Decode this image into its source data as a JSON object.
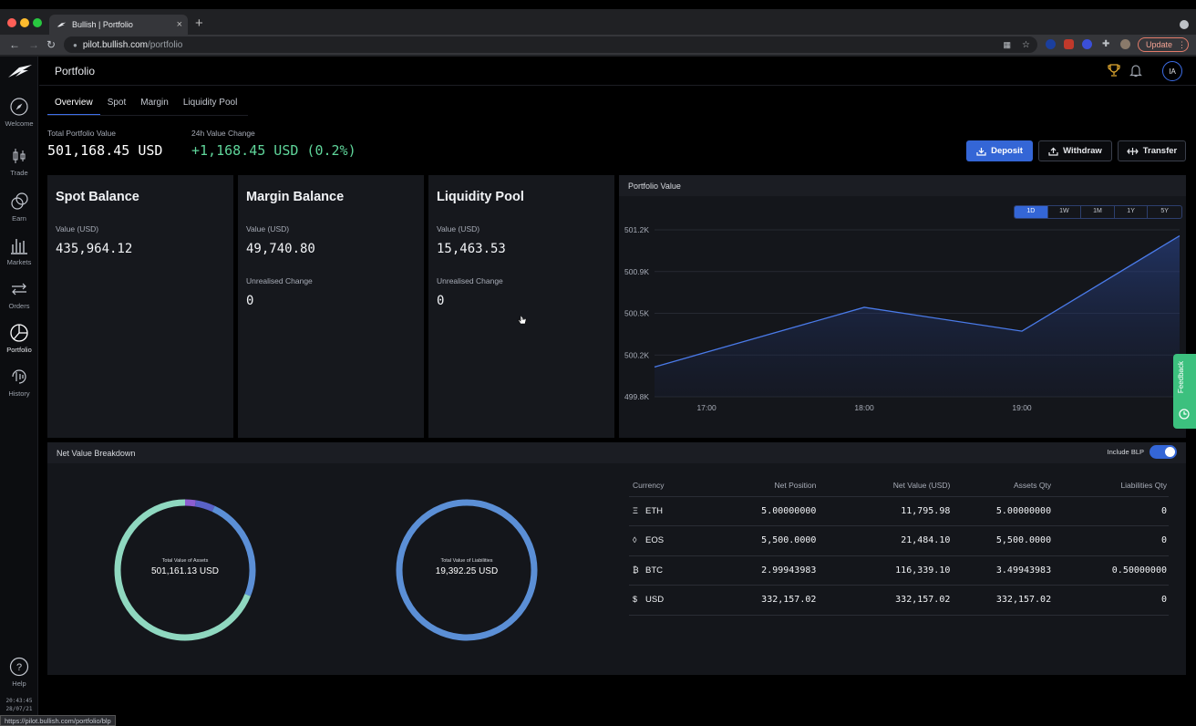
{
  "browser": {
    "tab_title": "Bullish | Portfolio",
    "tab_close": "×",
    "new_tab": "+",
    "url_host": "pilot.bullish.com",
    "url_path": "/portfolio",
    "update_label": "Update",
    "status_url": "https://pilot.bullish.com/portfolio/blp"
  },
  "sidebar": {
    "items": [
      {
        "label": "Welcome",
        "icon": "compass-icon"
      },
      {
        "label": "Trade",
        "icon": "candlestick-icon"
      },
      {
        "label": "Earn",
        "icon": "coins-icon"
      },
      {
        "label": "Markets",
        "icon": "bar-chart-icon"
      },
      {
        "label": "Orders",
        "icon": "arrows-icon"
      },
      {
        "label": "Portfolio",
        "icon": "pie-chart-icon"
      },
      {
        "label": "History",
        "icon": "history-icon"
      }
    ],
    "help_label": "Help",
    "clock_time": "20:43:45",
    "clock_date": "28/07/21"
  },
  "header": {
    "title": "Portfolio",
    "avatar_initials": "IA"
  },
  "tabs": [
    "Overview",
    "Spot",
    "Margin",
    "Liquidity Pool"
  ],
  "summary": {
    "total_label": "Total Portfolio Value",
    "total_value": "501,168.45 USD",
    "change_label": "24h Value Change",
    "change_value": "+1,168.45 USD (0.2%)"
  },
  "actions": {
    "deposit": "Deposit",
    "withdraw": "Withdraw",
    "transfer": "Transfer"
  },
  "cards": {
    "spot": {
      "title": "Spot Balance",
      "value_label": "Value (USD)",
      "value": "435,964.12"
    },
    "margin": {
      "title": "Margin Balance",
      "value_label": "Value (USD)",
      "value": "49,740.80",
      "change_label": "Unrealised Change",
      "change": "0"
    },
    "pool": {
      "title": "Liquidity Pool",
      "value_label": "Value (USD)",
      "value": "15,463.53",
      "change_label": "Unrealised Change",
      "change": "0"
    }
  },
  "portfolio_chart": {
    "title": "Portfolio Value",
    "ranges": [
      "1D",
      "1W",
      "1M",
      "1Y",
      "5Y"
    ],
    "active_range": "1D"
  },
  "chart_data": {
    "type": "area",
    "title": "Portfolio Value",
    "x": [
      "16:40",
      "18:00",
      "19:00",
      "20:00"
    ],
    "x_numeric_hours": [
      16.67,
      18.0,
      19.0,
      20.0
    ],
    "series": [
      {
        "values": [
          500.05,
          500.55,
          500.35,
          501.15
        ]
      }
    ],
    "x_ticks": [
      "17:00",
      "18:00",
      "19:00"
    ],
    "y_ticks": [
      "499.8K",
      "500.2K",
      "500.5K",
      "500.9K",
      "501.2K"
    ],
    "y_tick_values": [
      499.8,
      500.15,
      500.5,
      500.85,
      501.2
    ],
    "ylim": [
      499.8,
      501.2
    ],
    "xlim": [
      16.67,
      20.0
    ],
    "grid": true,
    "line_color": "#4a7ae8"
  },
  "breakdown": {
    "title": "Net Value Breakdown",
    "blp_label": "Include BLP",
    "assets_label": "Total Value of Assets",
    "assets_value": "501,161.13 USD",
    "liab_label": "Total Value of Liabilities",
    "liab_value": "19,392.25 USD",
    "assets_segments": [
      {
        "currency": "USD",
        "value": 332157.02,
        "color": "#8fd8c0"
      },
      {
        "currency": "BTC",
        "value": 116339.1,
        "color": "#5b8fd6"
      },
      {
        "currency": "EOS",
        "value": 21484.1,
        "color": "#5a62c8"
      },
      {
        "currency": "ETH",
        "value": 11795.98,
        "color": "#8d5ed0"
      }
    ],
    "liab_segments": [
      {
        "currency": "BTC",
        "value": 19392.25,
        "color": "#5b8fd6"
      }
    ],
    "columns": [
      "Currency",
      "Net Position",
      "Net Value (USD)",
      "Assets Qty",
      "Liabilities Qty"
    ],
    "rows": [
      {
        "icon": "Ξ",
        "currency": "ETH",
        "net_position": "5.00000000",
        "net_value": "11,795.98",
        "assets_qty": "5.00000000",
        "liab_qty": "0"
      },
      {
        "icon": "◊",
        "currency": "EOS",
        "net_position": "5,500.0000",
        "net_value": "21,484.10",
        "assets_qty": "5,500.0000",
        "liab_qty": "0"
      },
      {
        "icon": "₿",
        "currency": "BTC",
        "net_position": "2.99943983",
        "net_value": "116,339.10",
        "assets_qty": "3.49943983",
        "liab_qty": "0.50000000"
      },
      {
        "icon": "$",
        "currency": "USD",
        "net_position": "332,157.02",
        "net_value": "332,157.02",
        "assets_qty": "332,157.02",
        "liab_qty": "0"
      }
    ]
  },
  "feedback_label": "Feedback"
}
